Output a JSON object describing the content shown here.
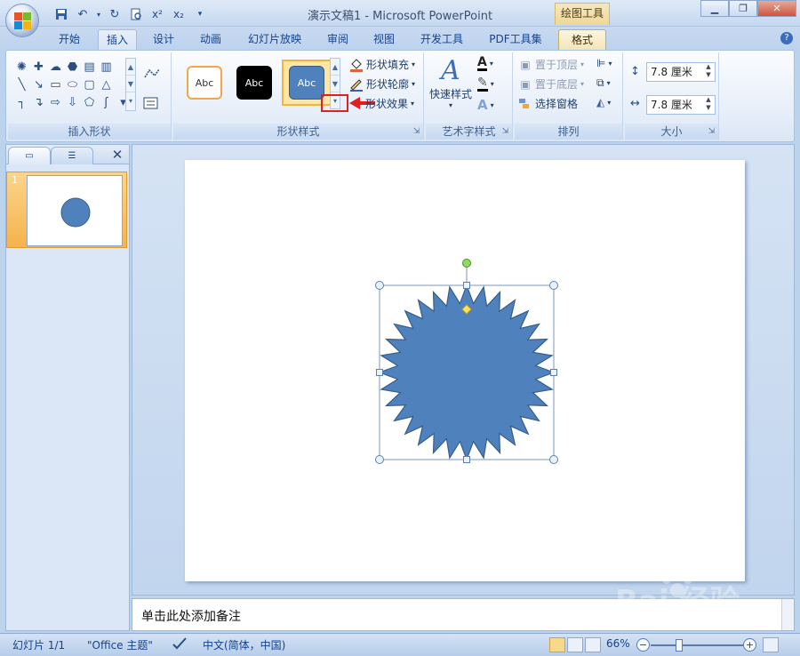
{
  "window": {
    "title": "演示文稿1 - Microsoft PowerPoint",
    "context_tab": "绘图工具"
  },
  "qat": {
    "icons": [
      "save-icon",
      "undo-icon",
      "redo-icon",
      "print-preview-icon",
      "superscript-icon",
      "subscript-icon",
      "customize-icon"
    ]
  },
  "tabs": [
    {
      "label": "开始"
    },
    {
      "label": "插入"
    },
    {
      "label": "设计"
    },
    {
      "label": "动画"
    },
    {
      "label": "幻灯片放映"
    },
    {
      "label": "审阅"
    },
    {
      "label": "视图"
    },
    {
      "label": "开发工具"
    },
    {
      "label": "PDF工具集"
    },
    {
      "label": "格式"
    }
  ],
  "ribbon": {
    "insert_shapes": {
      "label": "插入形状"
    },
    "shape_styles": {
      "label": "形状样式",
      "swatch_text": "Abc",
      "fill": "形状填充",
      "outline": "形状轮廓",
      "effects": "形状效果"
    },
    "wordart": {
      "label": "艺术字样式",
      "quick_styles": "快速样式"
    },
    "arrange": {
      "label": "排列",
      "bring_front": "置于顶层",
      "send_back": "置于底层",
      "selection_pane": "选择窗格"
    },
    "size": {
      "label": "大小",
      "height": "7.8 厘米",
      "width": "7.8 厘米"
    }
  },
  "slides_pane": {
    "slide_number": "1"
  },
  "notes": {
    "placeholder": "单击此处添加备注"
  },
  "status": {
    "slide": "幻灯片 1/1",
    "theme": "\"Office 主题\"",
    "language": "中文(简体，中国)",
    "zoom": "66%"
  },
  "watermark": {
    "text": "Bai 经验"
  },
  "colors": {
    "shape_fill": "#4f81bd",
    "shape_stroke": "#385d8a",
    "highlight_red": "#e02020",
    "context_gold": "#f0d796"
  }
}
